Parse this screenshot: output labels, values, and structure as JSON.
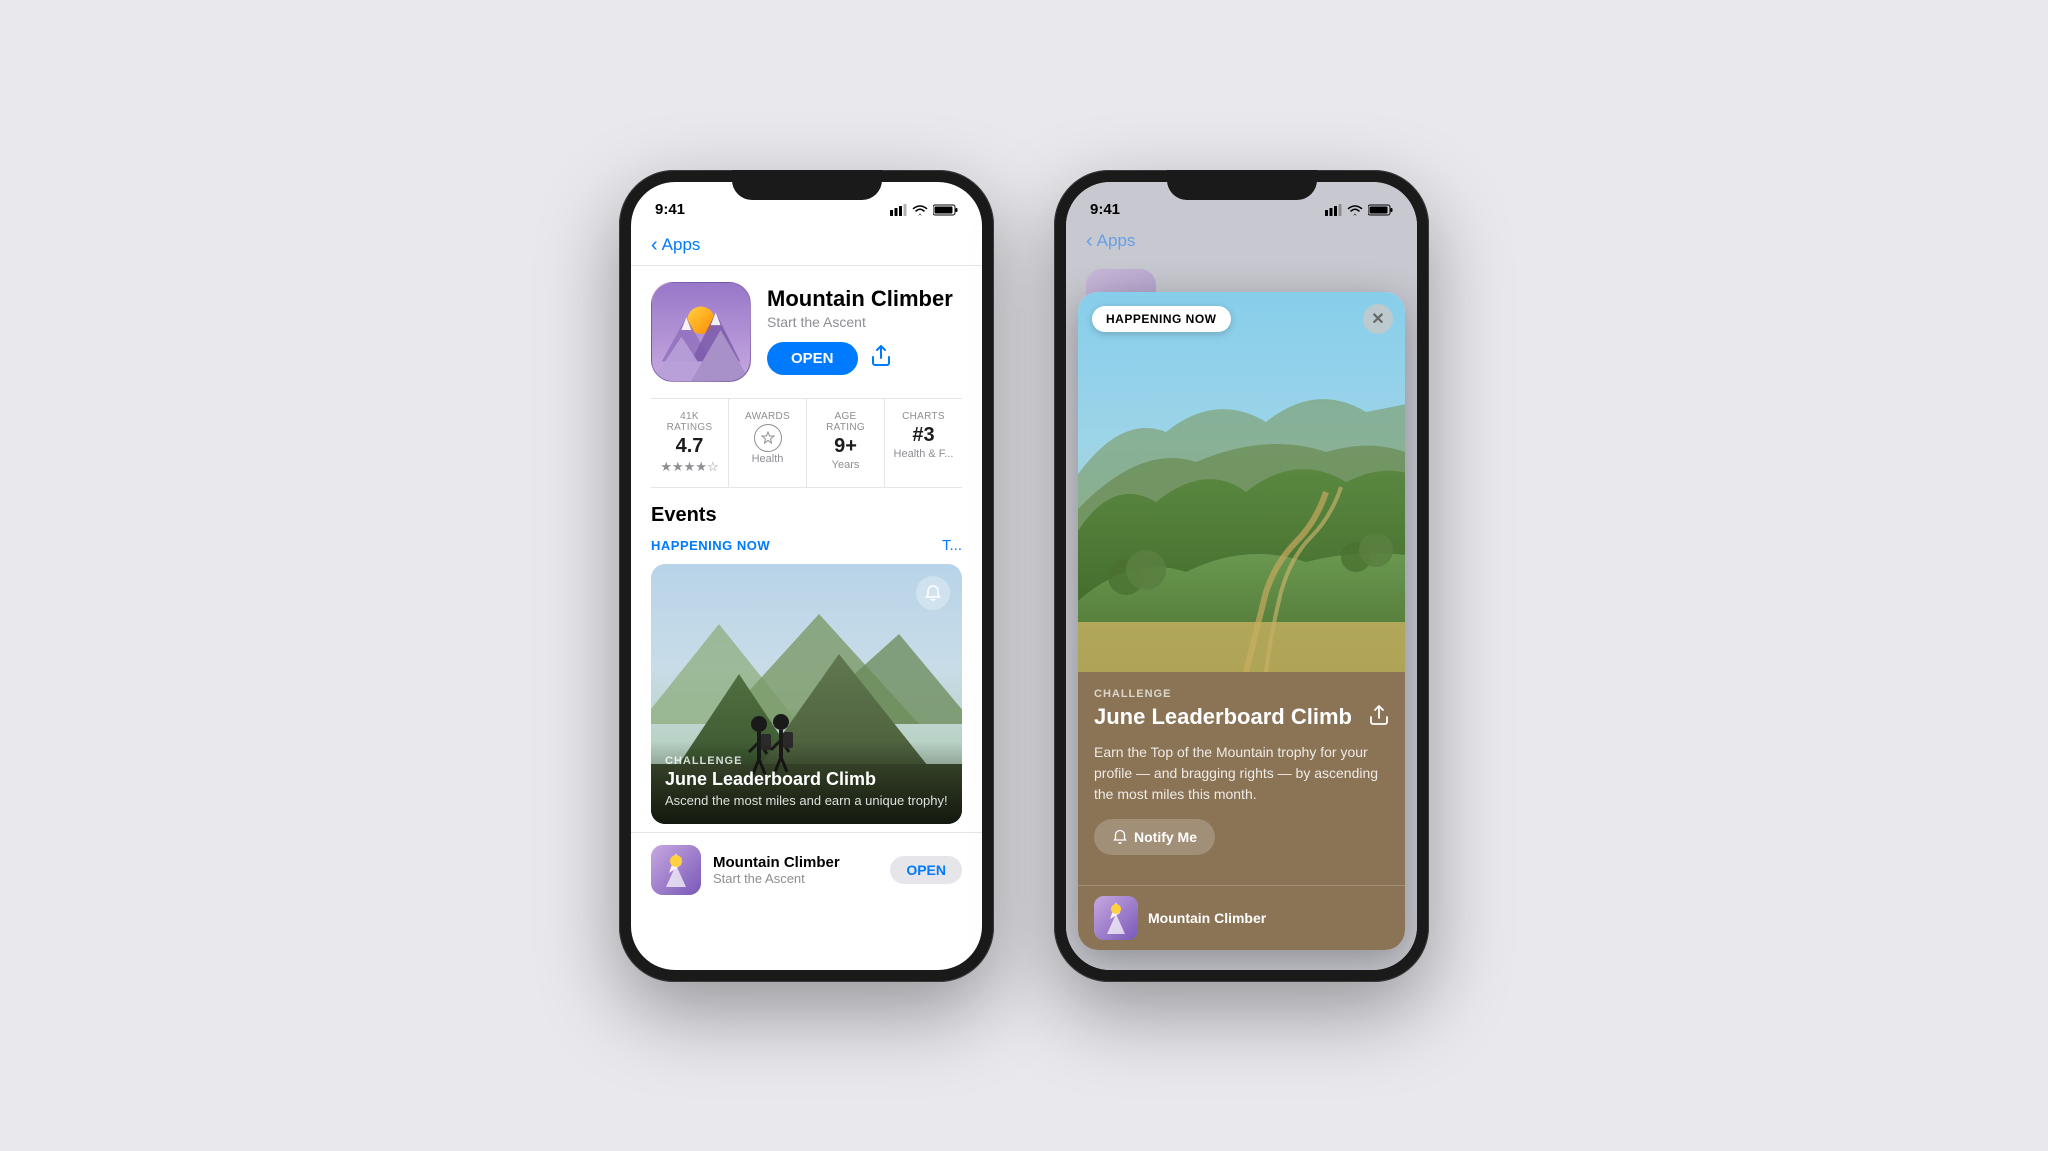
{
  "page": {
    "bg_color": "#e8e8ed"
  },
  "phone1": {
    "status": {
      "time": "9:41",
      "signal_bars": "▌▌▌",
      "wifi": "wifi",
      "battery": "battery"
    },
    "nav": {
      "back_label": "Apps"
    },
    "app": {
      "name": "Mountain Climber",
      "subtitle": "Start the Ascent",
      "open_btn": "OPEN",
      "ratings_label": "41K RATINGS",
      "rating_value": "4.7",
      "awards_label": "AWARDS",
      "awards_value": "Editors'\nChoice",
      "awards_sub": "Health",
      "age_label": "AGE RATING",
      "age_value": "9+",
      "age_sub": "Years",
      "charts_label": "CHARTS",
      "charts_value": "#3",
      "charts_sub": "Health & F..."
    },
    "events": {
      "section_title": "Events",
      "happening_label": "HAPPENING NOW",
      "today_label": "T...",
      "event_type": "CHALLENGE",
      "event_title": "June Leaderboard Climb",
      "event_desc": "Ascend the most miles and earn a unique trophy!",
      "bottom_app_name": "Mountain Climber",
      "bottom_app_sub": "Start the Ascent",
      "bottom_open_btn": "OPEN"
    }
  },
  "phone2": {
    "status": {
      "time": "9:41"
    },
    "nav": {
      "back_label": "Apps"
    },
    "app": {
      "name": "Mountain Climber"
    },
    "modal": {
      "happening_badge": "HAPPENING NOW",
      "close_btn": "✕",
      "challenge_label": "CHALLENGE",
      "event_title": "June Leaderboard Climb",
      "event_desc": "Earn the Top of the Mountain trophy for your profile — and bragging rights — by ascending the most miles this month.",
      "notify_btn": "Notify Me",
      "bottom_app_name": "Mountain Climber"
    }
  }
}
